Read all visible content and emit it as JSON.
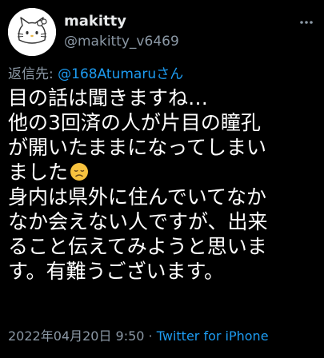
{
  "user": {
    "display_name": "makitty",
    "handle": "@makitty_v6469",
    "avatar_icon": "kitty-avatar"
  },
  "reply": {
    "prefix": "返信先: ",
    "to_user": "@168Atumaruさん"
  },
  "tweet": {
    "lines": [
      "目の話は聞きますね…",
      "他の3回済の人が片目の瞳孔",
      "が開いたままになってしまい",
      "ました",
      "身内は県外に住んでいてなか",
      "なか会えない人ですが、出来",
      "ること伝えてみようと思いま",
      "す。有難うございます。"
    ],
    "emoji_icon": "disappointed-face-emoji"
  },
  "meta": {
    "timestamp": "2022年04月20日 9:50",
    "separator": " · ",
    "source": "Twitter for iPhone"
  },
  "colors": {
    "background": "#000000",
    "text": "#ffffff",
    "secondary": "#8b98a5",
    "link": "#1d9bf0"
  }
}
